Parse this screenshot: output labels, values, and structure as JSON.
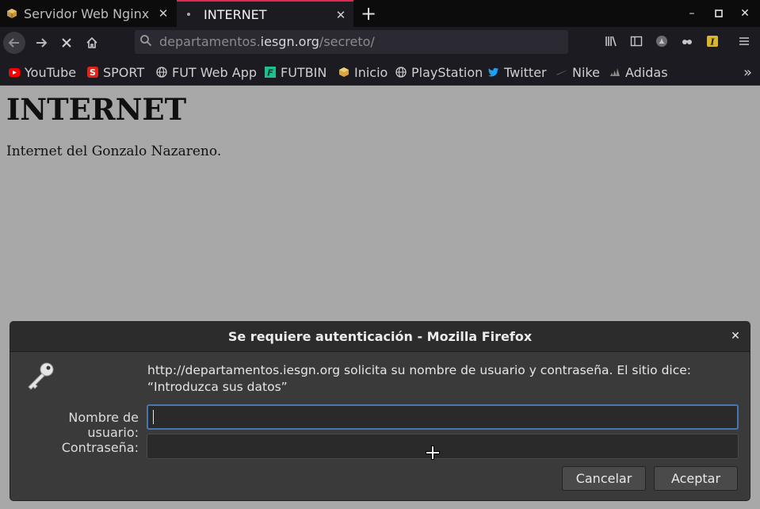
{
  "browser": {
    "tabs": [
      {
        "title": "Servidor Web Nginx | ",
        "active": false,
        "favicon": "nginx-cube-icon"
      },
      {
        "title": "INTERNET",
        "active": true,
        "favicon": "loading-dot-icon"
      }
    ],
    "url": {
      "prefix": "departamentos.",
      "domain": "iesgn.org",
      "path": "/secreto/"
    },
    "bookmarks": [
      {
        "label": "YouTube",
        "icon": "youtube-icon",
        "color": "#ff0000"
      },
      {
        "label": "SPORT",
        "icon": "sport-icon",
        "color": "#e2231a"
      },
      {
        "label": "FUT Web App",
        "icon": "globe-icon",
        "color": "#cfcfd1"
      },
      {
        "label": "FUTBIN",
        "icon": "futbin-icon",
        "color": "#1fbf8f"
      },
      {
        "label": "Inicio",
        "icon": "cube-icon",
        "color": "#d9a441"
      },
      {
        "label": "PlayStation",
        "icon": "globe-icon",
        "color": "#cfcfd1"
      },
      {
        "label": "Twitter",
        "icon": "twitter-icon",
        "color": "#1da1f2"
      },
      {
        "label": "Nike",
        "icon": "nike-icon",
        "color": "#555555"
      },
      {
        "label": "Adidas",
        "icon": "adidas-icon",
        "color": "#777777"
      }
    ]
  },
  "page": {
    "title": "INTERNET",
    "text": "Internet del Gonzalo Nazareno."
  },
  "dialog": {
    "title": "Se requiere autenticación - Mozilla Firefox",
    "message": "http://departamentos.iesgn.org solicita su nombre de usuario y contraseña. El sitio dice: “Introduzca sus datos”",
    "username_label": "Nombre de usuario:",
    "password_label": "Contraseña:",
    "username_value": "",
    "password_value": "",
    "cancel_label": "Cancelar",
    "accept_label": "Aceptar"
  },
  "colors": {
    "accent_tab": "#e22850",
    "focus": "#4677b4",
    "page_bg": "#a8a8a8"
  }
}
